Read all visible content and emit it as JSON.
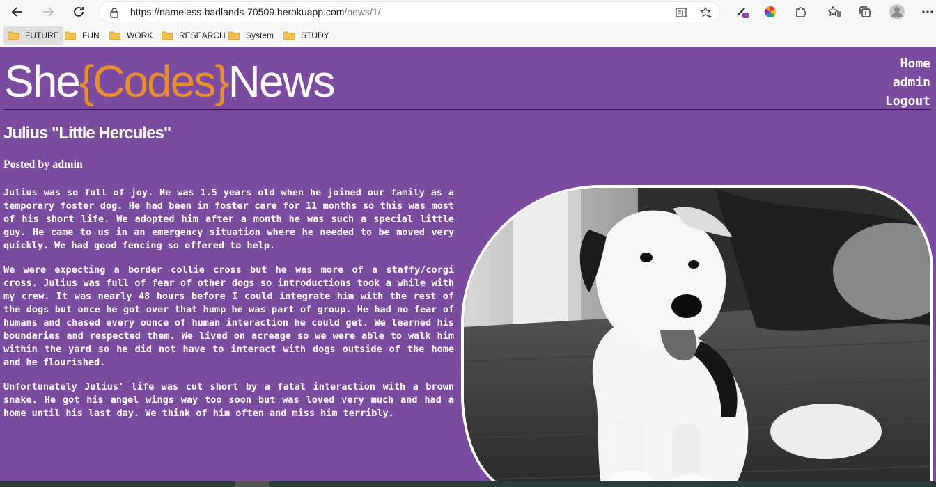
{
  "browser": {
    "url_main": "https://nameless-badlands-70509.herokuapp.com",
    "url_path": "/news/1/"
  },
  "bookmarks": [
    {
      "label": "FUTURE"
    },
    {
      "label": "FUN"
    },
    {
      "label": "WORK"
    },
    {
      "label": "RESEARCH"
    },
    {
      "label": "System"
    },
    {
      "label": "STUDY"
    }
  ],
  "site": {
    "logo_she": "She",
    "logo_codes": "{Codes}",
    "logo_news": "News",
    "nav": {
      "home": "Home",
      "admin": "admin",
      "logout": "Logout"
    },
    "accent_color": "#e88e2c",
    "background_color": "#7b4ba0"
  },
  "article": {
    "title": "Julius \"Little Hercules\"",
    "byline": "Posted by admin",
    "paragraphs": [
      "Julius was so full of joy. He was 1.5 years old when he joined our family as a temporary foster dog. He had been in foster care for 11 months so this was most of his short life. We adopted him after a month he was such a special little guy. He came to us in an emergency situation where he needed to be moved very quickly. We had good fencing so offered to help.",
      "We were expecting a border collie cross but he was more of a staffy/corgi cross. Julius was full of fear of other dogs so introductions took a while with my crew. It was nearly 48 hours before I could integrate him with the rest of the dogs but once he got over that hump he was part of group. He had no fear of humans and chased every ounce of human interaction he could get. We learned his boundaries and respected them. We lived on acreage so we were able to walk him within the yard so he did not have to interact with dogs outside of the home and he flourished.",
      "Unfortunately Julius' life was cut short by a fatal interaction with a brown snake. He got his angel wings way too soon but was loved very much and had a home until his last day. We think of him often and miss him terribly."
    ]
  }
}
